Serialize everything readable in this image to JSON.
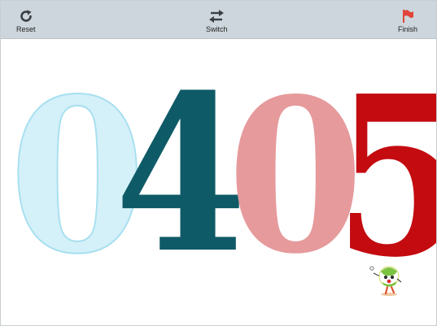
{
  "toolbar": {
    "reset_label": "Reset",
    "switch_label": "Switch",
    "finish_label": "Finish",
    "reset_icon": "refresh-icon",
    "switch_icon": "swap-arrows-icon",
    "finish_icon": "flag-icon"
  },
  "digits": {
    "d1": "0",
    "d2": "4",
    "d3": "0",
    "d4": "5"
  },
  "colors": {
    "toolbar_bg": "#cdd6dc",
    "digit1": "#d4f0f8",
    "digit2": "#0f5a67",
    "digit3": "#e69a9c",
    "digit4": "#c30b10",
    "flag": "#e0453a"
  }
}
